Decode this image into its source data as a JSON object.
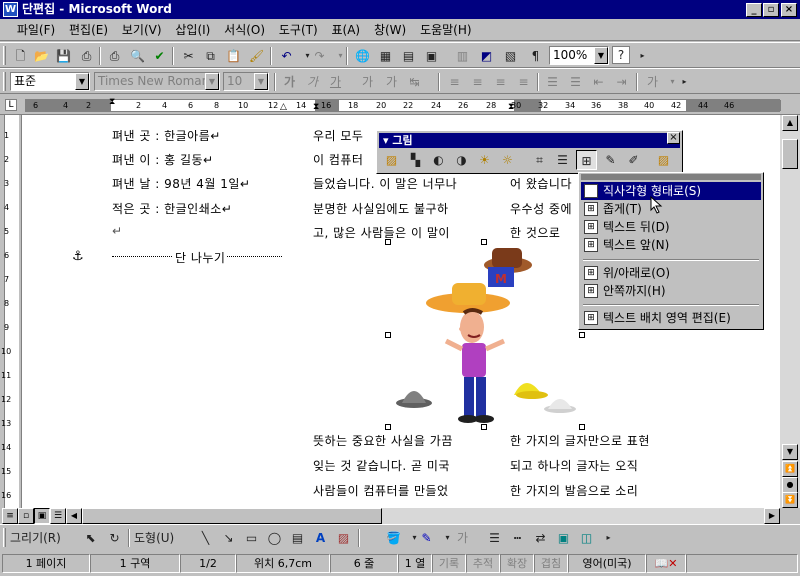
{
  "window": {
    "title": "단편집 - Microsoft Word",
    "min": "_",
    "max": "▫",
    "close": "×"
  },
  "menu": [
    "파일(F)",
    "편집(E)",
    "보기(V)",
    "삽입(I)",
    "서식(O)",
    "도구(T)",
    "표(A)",
    "창(W)",
    "도움말(H)"
  ],
  "toolbar": {
    "zoom": "100%",
    "help": "?"
  },
  "format": {
    "style": "표준",
    "font": "Times New Roman",
    "size": "10"
  },
  "ruler": {
    "ticks": [
      "6",
      "4",
      "2",
      "",
      "2",
      "4",
      "6",
      "8",
      "10",
      "12",
      "14",
      "16",
      "18",
      "20",
      "22",
      "24",
      "26",
      "28",
      "30",
      "32",
      "34",
      "36",
      "38",
      "40",
      "42",
      "44",
      "46"
    ]
  },
  "vruler": {
    "ticks": [
      "1",
      "2",
      "3",
      "4",
      "5",
      "6",
      "7",
      "8",
      "9",
      "10",
      "11",
      "12",
      "13",
      "14",
      "15",
      "16"
    ]
  },
  "doc": {
    "left": [
      "펴낸 곳 : 한글아름↵",
      "펴낸 이 : 홍 길동↵",
      "펴낸 날 : 98년 4월 1일↵",
      "적은 곳 : 한글인쇄소↵",
      "↵"
    ],
    "section_break": "단 나누기",
    "mid": [
      "우리 모두",
      "이 컴퓨터",
      "들었습니다. 이 말은 너무나",
      "분명한 사실임에도 불구하",
      "고, 많은 사람들은 이 말이"
    ],
    "right": [
      "",
      "",
      "어 왔습니다",
      "우수성 중에",
      "한 것으로"
    ],
    "bottom_mid": [
      "뜻하는 중요한 사실을 가끔",
      "잊는 것 같습니다. 곧 미국",
      "사람들이 컴퓨터를 만들었"
    ],
    "bottom_right": [
      "한 가지의 글자만으로 표현",
      "되고 하나의 글자는 오직",
      "한 가지의 발음으로 소리"
    ]
  },
  "palette": {
    "title": "그림",
    "close": "×"
  },
  "wrap_menu": {
    "items": [
      {
        "label": "직사각형 형태로(S)",
        "highlight": true
      },
      {
        "label": "좁게(T)"
      },
      {
        "label": "텍스트 뒤(D)"
      },
      {
        "label": "텍스트 앞(N)"
      },
      {
        "label": "위/아래로(O)"
      },
      {
        "label": "안쪽까지(H)"
      },
      {
        "label": "텍스트 배치 영역 편집(E)"
      }
    ]
  },
  "drawbar": {
    "draw": "그리기(R)",
    "shapes": "도형(U)"
  },
  "status": {
    "page": "1 페이지",
    "section": "1 구역",
    "pages": "1/2",
    "pos": "위치 6,7cm",
    "line": "6 줄",
    "col": "1 열",
    "rec": "기록",
    "trk": "추적",
    "ext": "확장",
    "ovr": "겹침",
    "lang": "영어(미국)"
  },
  "colors": {
    "titlebar": "#000080",
    "face": "#c0c0c0",
    "highlight": "#000080"
  }
}
